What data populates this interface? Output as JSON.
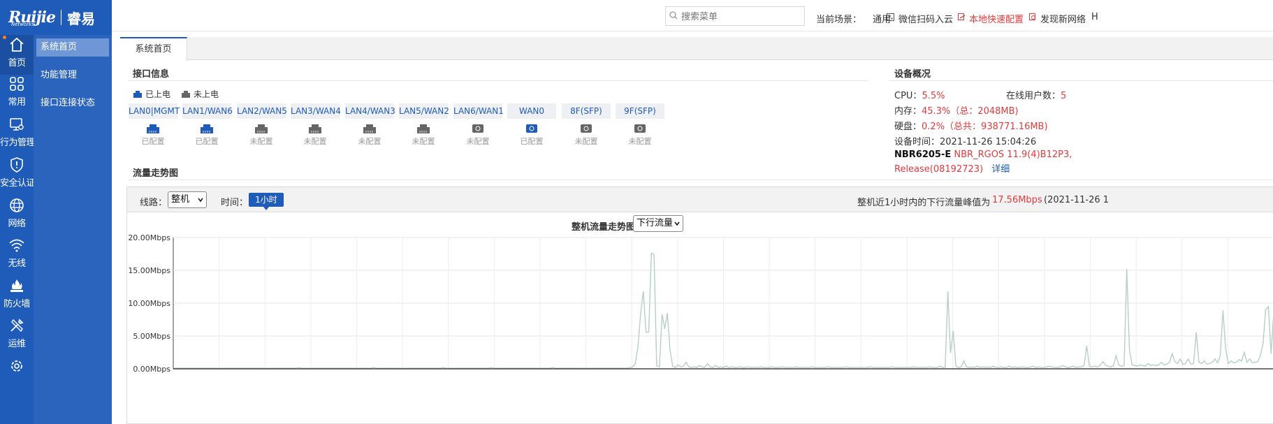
{
  "logo": {
    "brand": "Ruijie",
    "brand_sub": "Networks",
    "cn_name": "睿易"
  },
  "rail": [
    {
      "label": "首页",
      "icon": "home-icon",
      "active": true
    },
    {
      "label": "常用",
      "icon": "grid-icon"
    },
    {
      "label": "行为管理",
      "icon": "monitor-gear-icon"
    },
    {
      "label": "安全认证",
      "icon": "shield-icon"
    },
    {
      "label": "网络",
      "icon": "globe-icon"
    },
    {
      "label": "无线",
      "icon": "wifi-icon"
    },
    {
      "label": "防火墙",
      "icon": "firewall-icon"
    },
    {
      "label": "运维",
      "icon": "tools-icon"
    }
  ],
  "submenu": [
    {
      "label": "系统首页",
      "active": true
    },
    {
      "label": "功能管理"
    },
    {
      "label": "接口连接状态"
    }
  ],
  "header": {
    "search_placeholder": "搜索菜单",
    "scene_label": "当前场景：",
    "scene_value": "通用",
    "wechat": "微信扫码入云",
    "quick_config": "本地快速配置",
    "discover": "发现新网络",
    "trailing": "H"
  },
  "tab": {
    "label": "系统首页"
  },
  "ports_section": {
    "title": "接口信息",
    "legend_on": "已上电",
    "legend_off": "未上电",
    "ports": [
      {
        "name": "LAN0|MGMT",
        "status": "已配置",
        "powered": true,
        "type": "rj45"
      },
      {
        "name": "LAN1/WAN6",
        "status": "已配置",
        "powered": true,
        "type": "rj45"
      },
      {
        "name": "LAN2/WAN5",
        "status": "未配置",
        "powered": false,
        "type": "rj45"
      },
      {
        "name": "LAN3/WAN4",
        "status": "未配置",
        "powered": false,
        "type": "rj45"
      },
      {
        "name": "LAN4/WAN3",
        "status": "未配置",
        "powered": false,
        "type": "rj45"
      },
      {
        "name": "LAN5/WAN2",
        "status": "未配置",
        "powered": false,
        "type": "rj45"
      },
      {
        "name": "LAN6/WAN1",
        "status": "未配置",
        "powered": false,
        "type": "sfp"
      },
      {
        "name": "WAN0",
        "status": "已配置",
        "powered": true,
        "type": "sfp"
      },
      {
        "name": "8F(SFP)",
        "status": "未配置",
        "powered": false,
        "type": "sfp"
      },
      {
        "name": "9F(SFP)",
        "status": "未配置",
        "powered": false,
        "type": "sfp"
      }
    ]
  },
  "device": {
    "title": "设备概况",
    "cpu_label": "CPU：",
    "cpu_value": "5.5%",
    "users_label": "在线用户数：",
    "users_value": "5",
    "mem_label": "内存：",
    "mem_value": "45.3%（总：2048MB)",
    "disk_label": "硬盘：",
    "disk_value": "0.2%（总共：938771.16MB)",
    "time_label": "设备时间：",
    "time_value": "2021-11-26 15:04:26",
    "model": "NBR6205-E",
    "version_line1": "NBR_RGOS 11.9(4)B12P3,",
    "version_line2": "Release(08192723)",
    "detail_link": "详细"
  },
  "traffic": {
    "title": "流量走势图",
    "line_label": "线路：",
    "line_value": "整机",
    "time_label": "时间：",
    "time_value": "1小时",
    "peak_prefix": "整机近1小时内的下行流量峰值为",
    "peak_value": "17.56Mbps",
    "peak_time": "(2021-11-26 1",
    "chart_title": "整机流量走势图",
    "chart_select": "下行流量"
  },
  "chart_data": {
    "type": "line",
    "title": "整机流量走势图",
    "ylim": [
      0,
      20
    ],
    "y_ticks": [
      "20.00Mbps",
      "15.00Mbps",
      "10.00Mbps",
      "5.00Mbps",
      "0.00Mbps"
    ],
    "grid": true,
    "series": [
      {
        "color": "#b7cfc4",
        "values": [
          0.1,
          0.1,
          0.1,
          0.1,
          0.1,
          0.1,
          0.1,
          0.1,
          0.1,
          0.1,
          0.1,
          0.1,
          0.1,
          0.1,
          0.1,
          0.1,
          0.1,
          0.1,
          0.1,
          0.1,
          0.1,
          0.1,
          0.1,
          0.1,
          0.1,
          0.1,
          0.1,
          0.1,
          0.1,
          0.1,
          0.1,
          0.1,
          0.1,
          0.1,
          0.1,
          0.1,
          0.1,
          0.1,
          0.1,
          0.1,
          0.1,
          0.1,
          0.1,
          0.1,
          0.1,
          0.1,
          0.1,
          0.2,
          0.1,
          0.1,
          0.1,
          0.1,
          0.1,
          0.1,
          0.1,
          0.1,
          0.1,
          0.1,
          0.1,
          0.1,
          0.1,
          0.1,
          0.1,
          0.1,
          0.1,
          0.1,
          0.1,
          0.1,
          0.1,
          0.1,
          0.1,
          0.1,
          0.1,
          0.1,
          0.1,
          0.2,
          0.1,
          0.1,
          0.1,
          0.1,
          0.1,
          0.1,
          0.1,
          0.1,
          0.1,
          0.1,
          0.1,
          0.1,
          0.1,
          0.1,
          0.1,
          0.1,
          0.1,
          0.1,
          0.1,
          0.1,
          0.1,
          0.1,
          0.1,
          0.1,
          0.1,
          0.2,
          0.1,
          0.1,
          0.1,
          0.1,
          0.1,
          0.1,
          0.1,
          0.1,
          0.1,
          0.1,
          0.1,
          0.1,
          0.1,
          0.1,
          0.1,
          0.1,
          0.1,
          0.2,
          0.1,
          0.1,
          0.1,
          0.1,
          0.1,
          0.1,
          0.1,
          0.1,
          0.1,
          0.1,
          0.1,
          0.1,
          0.1,
          0.1,
          0.1,
          0.1,
          0.1,
          0.1,
          0.1,
          0.1,
          0.1,
          0.1,
          0.2,
          0.1,
          0.1,
          0.1,
          0.1,
          0.1,
          0.1,
          0.1,
          0.1,
          0.1,
          0.1,
          0.1,
          0.1,
          0.1,
          0.1,
          0.1,
          0.1,
          0.1,
          0.1,
          0.1,
          0.1,
          0.1,
          0.1,
          0.1,
          0.1,
          0.1,
          0.1,
          0.1,
          0.1,
          0.2,
          0.3,
          0.8,
          3.5,
          8.5,
          11.8,
          5.6,
          5.6,
          17.6,
          17.4,
          0.5,
          0.3,
          8.3,
          6.1,
          8.5,
          2.8,
          0.4,
          0.2,
          0.6,
          0.3,
          0.4,
          1.0,
          0.3,
          0.2,
          0.3,
          0.2,
          0.5,
          0.3,
          0.2,
          0.8,
          0.3,
          0.2,
          0.5,
          0.2,
          0.3,
          0.2,
          0.4,
          0.2,
          0.3,
          0.2,
          0.2,
          0.3,
          0.2,
          0.2,
          0.3,
          0.2,
          0.2,
          0.2,
          0.2,
          0.3,
          0.2,
          0.2,
          0.2,
          0.3,
          0.2,
          0.2,
          0.2,
          0.3,
          0.2,
          0.2,
          0.2,
          0.2,
          0.3,
          0.2,
          0.2,
          0.2,
          0.2,
          0.2,
          0.3,
          0.2,
          0.2,
          0.2,
          0.2,
          0.2,
          0.3,
          0.2,
          0.2,
          0.2,
          0.2,
          0.2,
          0.2,
          0.3,
          0.2,
          0.2,
          0.2,
          0.2,
          0.2,
          0.2,
          0.2,
          0.2,
          0.3,
          0.2,
          0.2,
          0.2,
          0.2,
          0.2,
          0.2,
          0.2,
          0.3,
          0.2,
          0.2,
          0.2,
          0.2,
          0.2,
          0.2,
          0.2,
          0.3,
          0.2,
          0.2,
          0.2,
          0.2,
          0.2,
          0.3,
          0.2,
          0.2,
          0.2,
          0.4,
          0.2,
          0.2,
          11.8,
          2.4,
          5.8,
          0.4,
          0.2,
          0.3,
          1.2,
          0.3,
          0.2,
          0.3,
          0.2,
          0.4,
          0.2,
          0.3,
          0.2,
          0.3,
          0.2,
          0.4,
          0.2,
          0.2,
          0.3,
          0.2,
          0.2,
          0.4,
          0.2,
          0.3,
          0.2,
          0.2,
          0.3,
          0.2,
          0.2,
          0.3,
          0.4,
          0.2,
          0.3,
          0.2,
          0.2,
          0.3,
          0.4,
          0.3,
          0.2,
          0.2,
          0.3,
          0.5,
          0.3,
          0.2,
          0.3,
          0.4,
          0.2,
          0.3,
          0.3,
          0.5,
          3.5,
          0.4,
          0.3,
          0.4,
          0.3,
          0.5,
          1.1,
          0.6,
          0.4,
          0.3,
          0.5,
          2.0,
          0.6,
          0.4,
          0.5,
          15.2,
          2.8,
          0.6,
          0.5,
          0.4,
          0.6,
          0.5,
          0.4,
          0.8,
          0.5,
          0.6,
          0.5,
          0.6,
          1.0,
          0.6,
          0.7,
          1.0,
          2.3,
          1.1,
          0.8,
          1.5,
          0.7,
          0.8,
          1.5,
          0.7,
          0.8,
          5.6,
          1.0,
          0.8,
          1.2,
          0.7,
          0.8,
          1.0,
          1.5,
          0.9,
          2.0,
          8.9,
          3.1,
          0.8,
          1.2,
          0.9,
          1.0,
          1.4,
          1.2,
          2.5,
          1.0,
          1.5,
          0.9,
          1.0,
          1.1,
          2.0,
          3.8,
          9.0,
          9.5,
          2.3,
          8.5
        ]
      }
    ]
  }
}
